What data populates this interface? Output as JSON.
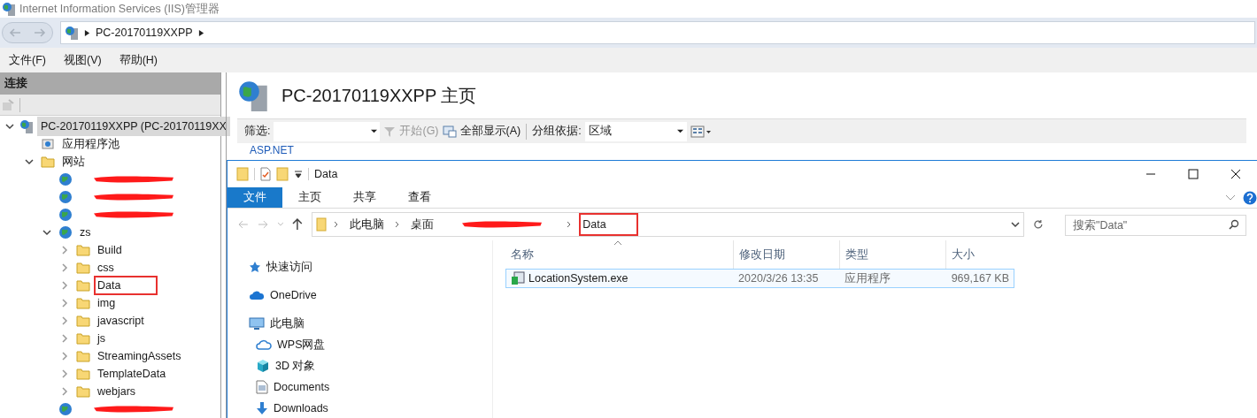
{
  "window": {
    "title": "Internet Information Services (IIS)管理器"
  },
  "nav_bar": {
    "crumbs": [
      "PC-20170119XXPP"
    ]
  },
  "menu": [
    "文件(F)",
    "视图(V)",
    "帮助(H)"
  ],
  "connections": {
    "title": "连接",
    "tree": [
      {
        "kind": "server",
        "label": "PC-20170119XXPP (PC-20170119XX",
        "selected": true,
        "expanded": true,
        "highlighted": false,
        "children": [
          {
            "kind": "pool",
            "label": "应用程序池",
            "selected": false,
            "highlighted": false
          },
          {
            "kind": "sites",
            "label": "网站",
            "selected": false,
            "expanded": true,
            "highlighted": false,
            "children": [
              {
                "kind": "redacted",
                "selected": false,
                "highlighted": false
              },
              {
                "kind": "redacted",
                "selected": false,
                "highlighted": false
              },
              {
                "kind": "redacted",
                "selected": false,
                "highlighted": false
              },
              {
                "kind": "site",
                "label": "zs",
                "selected": false,
                "expanded": true,
                "highlighted": false,
                "children": [
                  {
                    "kind": "folder",
                    "label": "Build",
                    "selected": false,
                    "expanded": false,
                    "highlighted": false
                  },
                  {
                    "kind": "folder",
                    "label": "css",
                    "selected": false,
                    "expanded": false,
                    "highlighted": false
                  },
                  {
                    "kind": "folder",
                    "label": "Data",
                    "selected": false,
                    "expanded": false,
                    "highlighted": true
                  },
                  {
                    "kind": "folder",
                    "label": "img",
                    "selected": false,
                    "expanded": false,
                    "highlighted": false
                  },
                  {
                    "kind": "folder",
                    "label": "javascript",
                    "selected": false,
                    "expanded": false,
                    "highlighted": false
                  },
                  {
                    "kind": "folder",
                    "label": "js",
                    "selected": false,
                    "expanded": false,
                    "highlighted": false
                  },
                  {
                    "kind": "folder",
                    "label": "StreamingAssets",
                    "selected": false,
                    "expanded": false,
                    "highlighted": false
                  },
                  {
                    "kind": "folder",
                    "label": "TemplateData",
                    "selected": false,
                    "expanded": false,
                    "highlighted": false
                  },
                  {
                    "kind": "folder",
                    "label": "webjars",
                    "selected": false,
                    "expanded": false,
                    "highlighted": false
                  }
                ]
              },
              {
                "kind": "redacted",
                "selected": false,
                "highlighted": false
              }
            ]
          }
        ]
      }
    ]
  },
  "home": {
    "title": "PC-20170119XXPP 主页",
    "filter_label": "筛选:",
    "start": "开始(G)",
    "show_all": "全部显示(A)",
    "group_label": "分组依据:",
    "group_value": "区域",
    "section": "ASP.NET"
  },
  "explorer": {
    "title": "Data",
    "ribbon_tabs": [
      {
        "label": "文件",
        "selected": true
      },
      {
        "label": "主页",
        "selected": false
      },
      {
        "label": "共享",
        "selected": false
      },
      {
        "label": "查看",
        "selected": false
      }
    ],
    "address": [
      {
        "kind": "text",
        "label": "此电脑",
        "highlighted": false
      },
      {
        "kind": "text",
        "label": "桌面",
        "highlighted": false
      },
      {
        "kind": "redacted",
        "highlighted": false
      },
      {
        "kind": "text",
        "label": "Data",
        "highlighted": true
      }
    ],
    "search": {
      "placeholder": "搜索\"Data\""
    },
    "nav_pane": [
      {
        "kind": "star",
        "label": "快速访问"
      },
      {
        "kind": "cloud",
        "label": "OneDrive"
      },
      {
        "kind": "pc",
        "label": "此电脑",
        "children": [
          {
            "kind": "wps",
            "label": "WPS网盘"
          },
          {
            "kind": "cube",
            "label": "3D 对象"
          },
          {
            "kind": "doc",
            "label": "Documents"
          },
          {
            "kind": "down",
            "label": "Downloads"
          }
        ]
      }
    ],
    "columns": [
      "名称",
      "修改日期",
      "类型",
      "大小"
    ],
    "rows": [
      {
        "cells": [
          "LocationSystem.exe",
          "2020/3/26 13:35",
          "应用程序",
          "969,167 KB"
        ],
        "selected": true
      }
    ]
  }
}
